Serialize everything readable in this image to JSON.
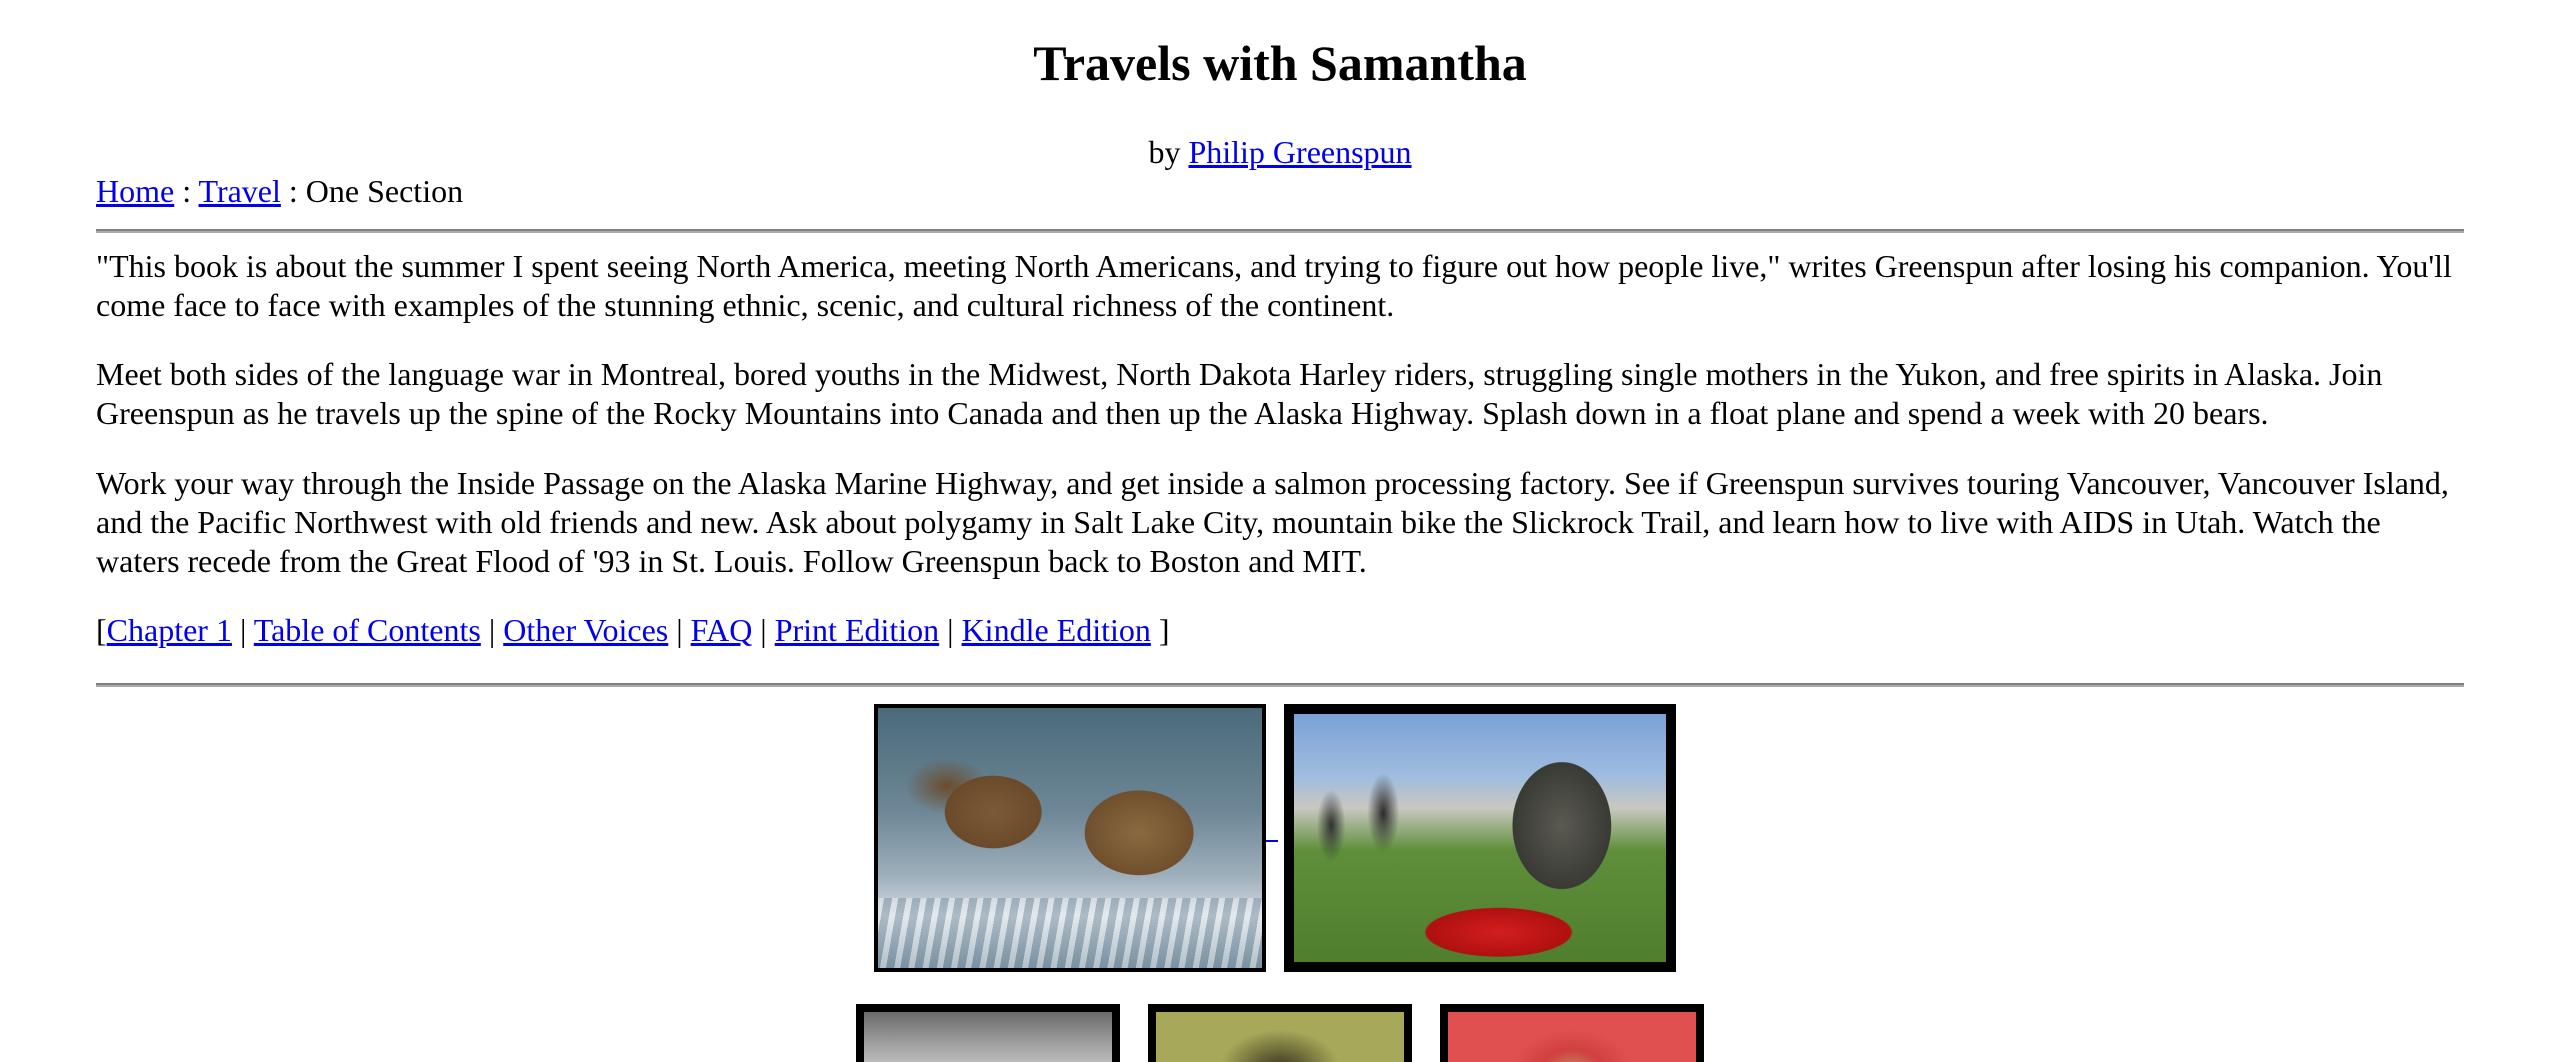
{
  "page": {
    "title": "Travels with Samantha",
    "byline_prefix": "by",
    "author": "Philip Greenspun"
  },
  "breadcrumb": {
    "home": "Home",
    "sep1": " : ",
    "travel": "Travel",
    "sep2": " : ",
    "current": "One Section"
  },
  "paragraphs": [
    "\"This book is about the summer I spent seeing North America, meeting North Americans, and trying to figure out how people live,\" writes Greenspun after losing his companion. You'll come face to face with examples of the stunning ethnic, scenic, and cultural richness of the continent.",
    "Meet both sides of the language war in Montreal, bored youths in the Midwest, North Dakota Harley riders, struggling single mothers in the Yukon, and free spirits in Alaska. Join Greenspun as he travels up the spine of the Rocky Mountains into Canada and then up the Alaska Highway. Splash down in a float plane and spend a week with 20 bears.",
    "Work your way through the Inside Passage on the Alaska Marine Highway, and get inside a salmon processing factory. See if Greenspun survives touring Vancouver, Vancouver Island, and the Pacific Northwest with old friends and new. Ask about polygamy in Salt Lake City, mountain bike the Slickrock Trail, and learn how to live with AIDS in Utah. Watch the waters recede from the Great Flood of '93 in St. Louis. Follow Greenspun back to Boston and MIT."
  ],
  "nav": {
    "open_bracket": "[",
    "chapter1": "Chapter 1",
    "toc": "Table of Contents",
    "other_voices": "Other Voices",
    "faq": "FAQ",
    "print_edition": "Print Edition",
    "kindle_edition": "Kindle Edition",
    "separator": " | ",
    "close_bracket": " ]"
  }
}
